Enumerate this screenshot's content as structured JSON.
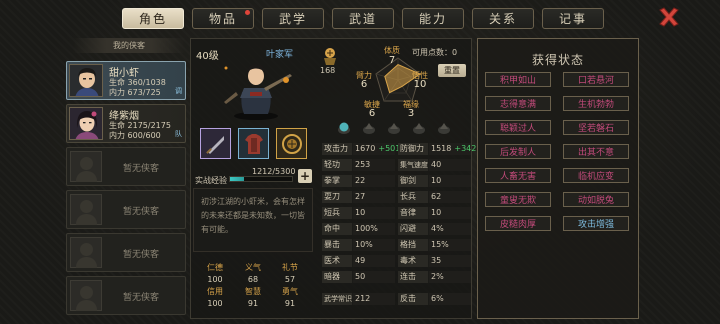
{
  "tabs": [
    {
      "label": "角色",
      "active": true
    },
    {
      "label": "物品",
      "active": false,
      "dot": true
    },
    {
      "label": "武学",
      "active": false
    },
    {
      "label": "武道",
      "active": false
    },
    {
      "label": "能力",
      "active": false
    },
    {
      "label": "关系",
      "active": false
    },
    {
      "label": "记事",
      "active": false
    }
  ],
  "party": {
    "header": "我的侠客",
    "members": [
      {
        "name": "甜小虾",
        "hp": "生命 360/1038",
        "mp": "内力 673/725",
        "badge": "调",
        "selected": true
      },
      {
        "name": "绛紫烟",
        "hp": "生命 2175/2175",
        "mp": "内力 600/600",
        "badge": "队",
        "selected": false
      }
    ],
    "empty_label": "暂无侠客"
  },
  "character": {
    "level": "40级",
    "faction": "叶家军",
    "exp_label": "实战经验",
    "exp_text": "1212/5300",
    "exp_ratio": 0.229,
    "description": "初涉江湖的小虾米，会有怎样的未来还都是未知数，一切皆有可能。",
    "virtues": [
      {
        "label": "仁德",
        "value": "100"
      },
      {
        "label": "义气",
        "value": "68"
      },
      {
        "label": "礼节",
        "value": "57"
      },
      {
        "label": "信用",
        "value": "100"
      },
      {
        "label": "智慧",
        "value": "91"
      },
      {
        "label": "勇气",
        "value": "91"
      }
    ]
  },
  "attributes": {
    "fame": "168",
    "points_label": "可用点数：0",
    "reset_label": "重置",
    "radar": [
      {
        "label": "体质",
        "value": "7"
      },
      {
        "label": "悟性",
        "value": "10"
      },
      {
        "label": "福缘",
        "value": "3"
      },
      {
        "label": "敏捷",
        "value": "6"
      },
      {
        "label": "臂力",
        "value": "6"
      }
    ]
  },
  "stats": {
    "left": [
      {
        "label": "攻击力",
        "value": "1670",
        "bonus": "+501"
      },
      {
        "label": "轻功",
        "value": "253"
      },
      {
        "label": "拳掌",
        "value": "22"
      },
      {
        "label": "耍刀",
        "value": "27"
      },
      {
        "label": "短兵",
        "value": "10"
      },
      {
        "label": "命中",
        "value": "100%"
      },
      {
        "label": "暴击",
        "value": "10%"
      },
      {
        "label": "医术",
        "value": "49"
      },
      {
        "label": "暗器",
        "value": "50"
      },
      {
        "label": "武学常识",
        "value": "212"
      }
    ],
    "right": [
      {
        "label": "防御力",
        "value": "1518",
        "bonus": "+342"
      },
      {
        "label": "集气速度",
        "value": "40"
      },
      {
        "label": "御剑",
        "value": "10"
      },
      {
        "label": "长兵",
        "value": "62"
      },
      {
        "label": "音律",
        "value": "10"
      },
      {
        "label": "闪避",
        "value": "4%"
      },
      {
        "label": "格挡",
        "value": "15%"
      },
      {
        "label": "毒术",
        "value": "35"
      },
      {
        "label": "连击",
        "value": "2%"
      },
      {
        "label": "反击",
        "value": "6%"
      }
    ]
  },
  "status": {
    "title": "获得状态",
    "items": [
      {
        "label": "积甲如山",
        "color": "pink"
      },
      {
        "label": "口若悬河",
        "color": "pink"
      },
      {
        "label": "志得意满",
        "color": "pink"
      },
      {
        "label": "生机勃勃",
        "color": "pink"
      },
      {
        "label": "聪颖过人",
        "color": "pink"
      },
      {
        "label": "坚若磐石",
        "color": "pink"
      },
      {
        "label": "后发制人",
        "color": "pink"
      },
      {
        "label": "出其不意",
        "color": "pink"
      },
      {
        "label": "人畜无害",
        "color": "pink"
      },
      {
        "label": "临机应变",
        "color": "pink"
      },
      {
        "label": "童叟无欺",
        "color": "pink"
      },
      {
        "label": "动如脱兔",
        "color": "pink"
      },
      {
        "label": "皮糙肉厚",
        "color": "pink"
      },
      {
        "label": "攻击增强",
        "color": "blue"
      }
    ]
  },
  "colors": {
    "accent_gold": "#d8a44a",
    "status_pink": "#c24a7a",
    "status_blue": "#7fbde0",
    "bonus_green": "#4cc76a",
    "exp_cyan": "#3dc8c2",
    "close_red": "#d2453b"
  }
}
